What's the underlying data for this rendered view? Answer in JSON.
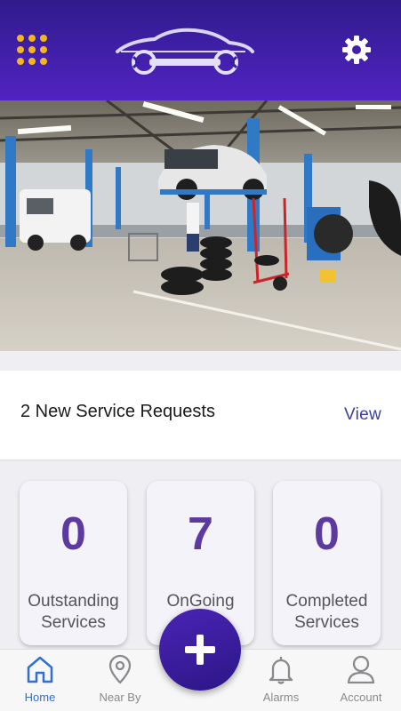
{
  "header": {
    "menu_icon": "grid-menu-icon",
    "logo_icon": "car-wrench-logo",
    "settings_icon": "gear-icon"
  },
  "banner": {
    "image": "auto-repair-garage-photo"
  },
  "requests": {
    "text": "2 New Service Requests",
    "view_label": "View"
  },
  "stats": [
    {
      "value": "0",
      "line1": "Outstanding",
      "line2": "Services"
    },
    {
      "value": "7",
      "line1": "OnGoing",
      "line2": ""
    },
    {
      "value": "0",
      "line1": "Completed",
      "line2": "Services"
    }
  ],
  "tabs": [
    {
      "label": "Home",
      "icon": "home-icon",
      "active": true
    },
    {
      "label": "Near By",
      "icon": "location-pin-icon"
    },
    {
      "label": "Alarms",
      "icon": "bell-icon"
    },
    {
      "label": "Account",
      "icon": "user-icon"
    }
  ],
  "fab": {
    "icon": "plus-icon"
  },
  "colors": {
    "header": "#3a1fa0",
    "accent_yellow": "#f5b51f",
    "stat_number": "#5d3aa0",
    "tab_active": "#2f6fd6"
  }
}
